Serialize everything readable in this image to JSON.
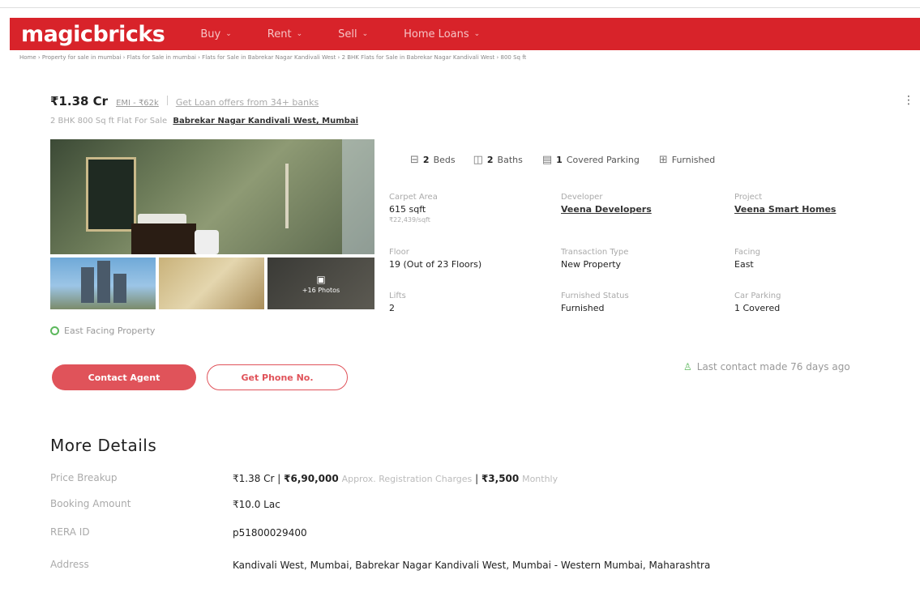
{
  "header": {
    "logo": "magicbricks",
    "nav": [
      "Buy",
      "Rent",
      "Sell",
      "Home Loans"
    ]
  },
  "breadcrumb": "Home › Property for sale in mumbai › Flats for Sale in mumbai › Flats for Sale in Babrekar Nagar Kandivali West › 2 BHK Flats for Sale in Babrekar Nagar Kandivali West › 800 Sq ft",
  "listing": {
    "price": "₹1.38 Cr",
    "emi": "EMI - ₹62k",
    "loan_offer": "Get Loan offers from 34+ banks",
    "subtitle_prefix": "2 BHK 800 Sq ft Flat For Sale",
    "location": "Babrekar Nagar Kandivali West, Mumbai",
    "photos_label": "+16 Photos",
    "facing_tag": "East Facing Property"
  },
  "amenities": [
    {
      "icon": "bed-icon",
      "count": "2",
      "label": "Beds"
    },
    {
      "icon": "bath-icon",
      "count": "2",
      "label": "Baths"
    },
    {
      "icon": "parking-icon",
      "count": "1",
      "label": "Covered Parking"
    },
    {
      "icon": "furnished-icon",
      "count": "",
      "label": "Furnished"
    }
  ],
  "facts": {
    "carpet_area": {
      "label": "Carpet Area",
      "value": "615 sqft",
      "sub": "₹22,439/sqft"
    },
    "developer": {
      "label": "Developer",
      "value": "Veena Developers"
    },
    "project": {
      "label": "Project",
      "value": "Veena Smart Homes"
    },
    "floor": {
      "label": "Floor",
      "value": "19 (Out of 23 Floors)"
    },
    "transaction": {
      "label": "Transaction Type",
      "value": "New Property"
    },
    "facing": {
      "label": "Facing",
      "value": "East"
    },
    "lifts": {
      "label": "Lifts",
      "value": "2"
    },
    "furnished": {
      "label": "Furnished Status",
      "value": "Furnished"
    },
    "car_parking": {
      "label": "Car Parking",
      "value": "1 Covered"
    }
  },
  "actions": {
    "contact_agent": "Contact Agent",
    "get_phone": "Get Phone No.",
    "last_contact": "Last contact made 76 days ago"
  },
  "more_details": {
    "title": "More Details",
    "price_breakup": {
      "label": "Price Breakup",
      "price": "₹1.38 Cr",
      "registration": "₹6,90,000",
      "registration_note": "Approx. Registration Charges",
      "monthly": "₹3,500",
      "monthly_note": "Monthly"
    },
    "booking": {
      "label": "Booking Amount",
      "value": "₹10.0 Lac"
    },
    "rera": {
      "label": "RERA ID",
      "value": "p51800029400"
    },
    "address": {
      "label": "Address",
      "value": "Kandivali West, Mumbai, Babrekar Nagar Kandivali West, Mumbai - Western Mumbai, Maharashtra"
    }
  },
  "colors": {
    "brand": "#d8232a",
    "accent": "#e0535a",
    "success": "#5cb85c"
  }
}
